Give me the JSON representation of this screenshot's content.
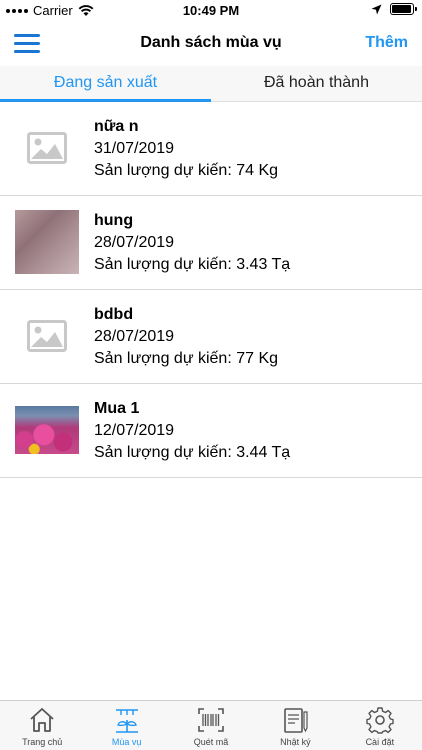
{
  "status_bar": {
    "carrier": "Carrier",
    "time": "10:49 PM",
    "battery_level": 0.95
  },
  "nav": {
    "title": "Danh sách mùa vụ",
    "add_label": "Thêm"
  },
  "tabs": [
    {
      "label": "Đang sản xuất",
      "active": true
    },
    {
      "label": "Đã hoàn thành",
      "active": false
    }
  ],
  "crops": [
    {
      "name": "nữa n",
      "date": "31/07/2019",
      "yield": "Sản lượng dự kiến: 74 Kg",
      "image": "placeholder-image-icon"
    },
    {
      "name": "hung",
      "date": "28/07/2019",
      "yield": "Sản lượng dự kiến: 3.43 Tạ",
      "image": "photo"
    },
    {
      "name": "bdbd",
      "date": "28/07/2019",
      "yield": "Sản lượng dự kiến: 77 Kg",
      "image": "placeholder-image-icon"
    },
    {
      "name": "Mua 1",
      "date": "12/07/2019",
      "yield": "Sản lượng dự kiến: 3.44 Tạ",
      "image": "photo"
    }
  ],
  "tab_bar": [
    {
      "label": "Trang chủ",
      "icon": "home-icon",
      "active": false
    },
    {
      "label": "Mùa vụ",
      "icon": "crop-season-icon",
      "active": true
    },
    {
      "label": "Quét mã",
      "icon": "barcode-scan-icon",
      "active": false
    },
    {
      "label": "Nhật ký",
      "icon": "journal-icon",
      "active": false
    },
    {
      "label": "Cài đặt",
      "icon": "gear-icon",
      "active": false
    }
  ],
  "colors": {
    "accent": "#2196f3",
    "placeholder_gray": "#c8c8c8"
  }
}
